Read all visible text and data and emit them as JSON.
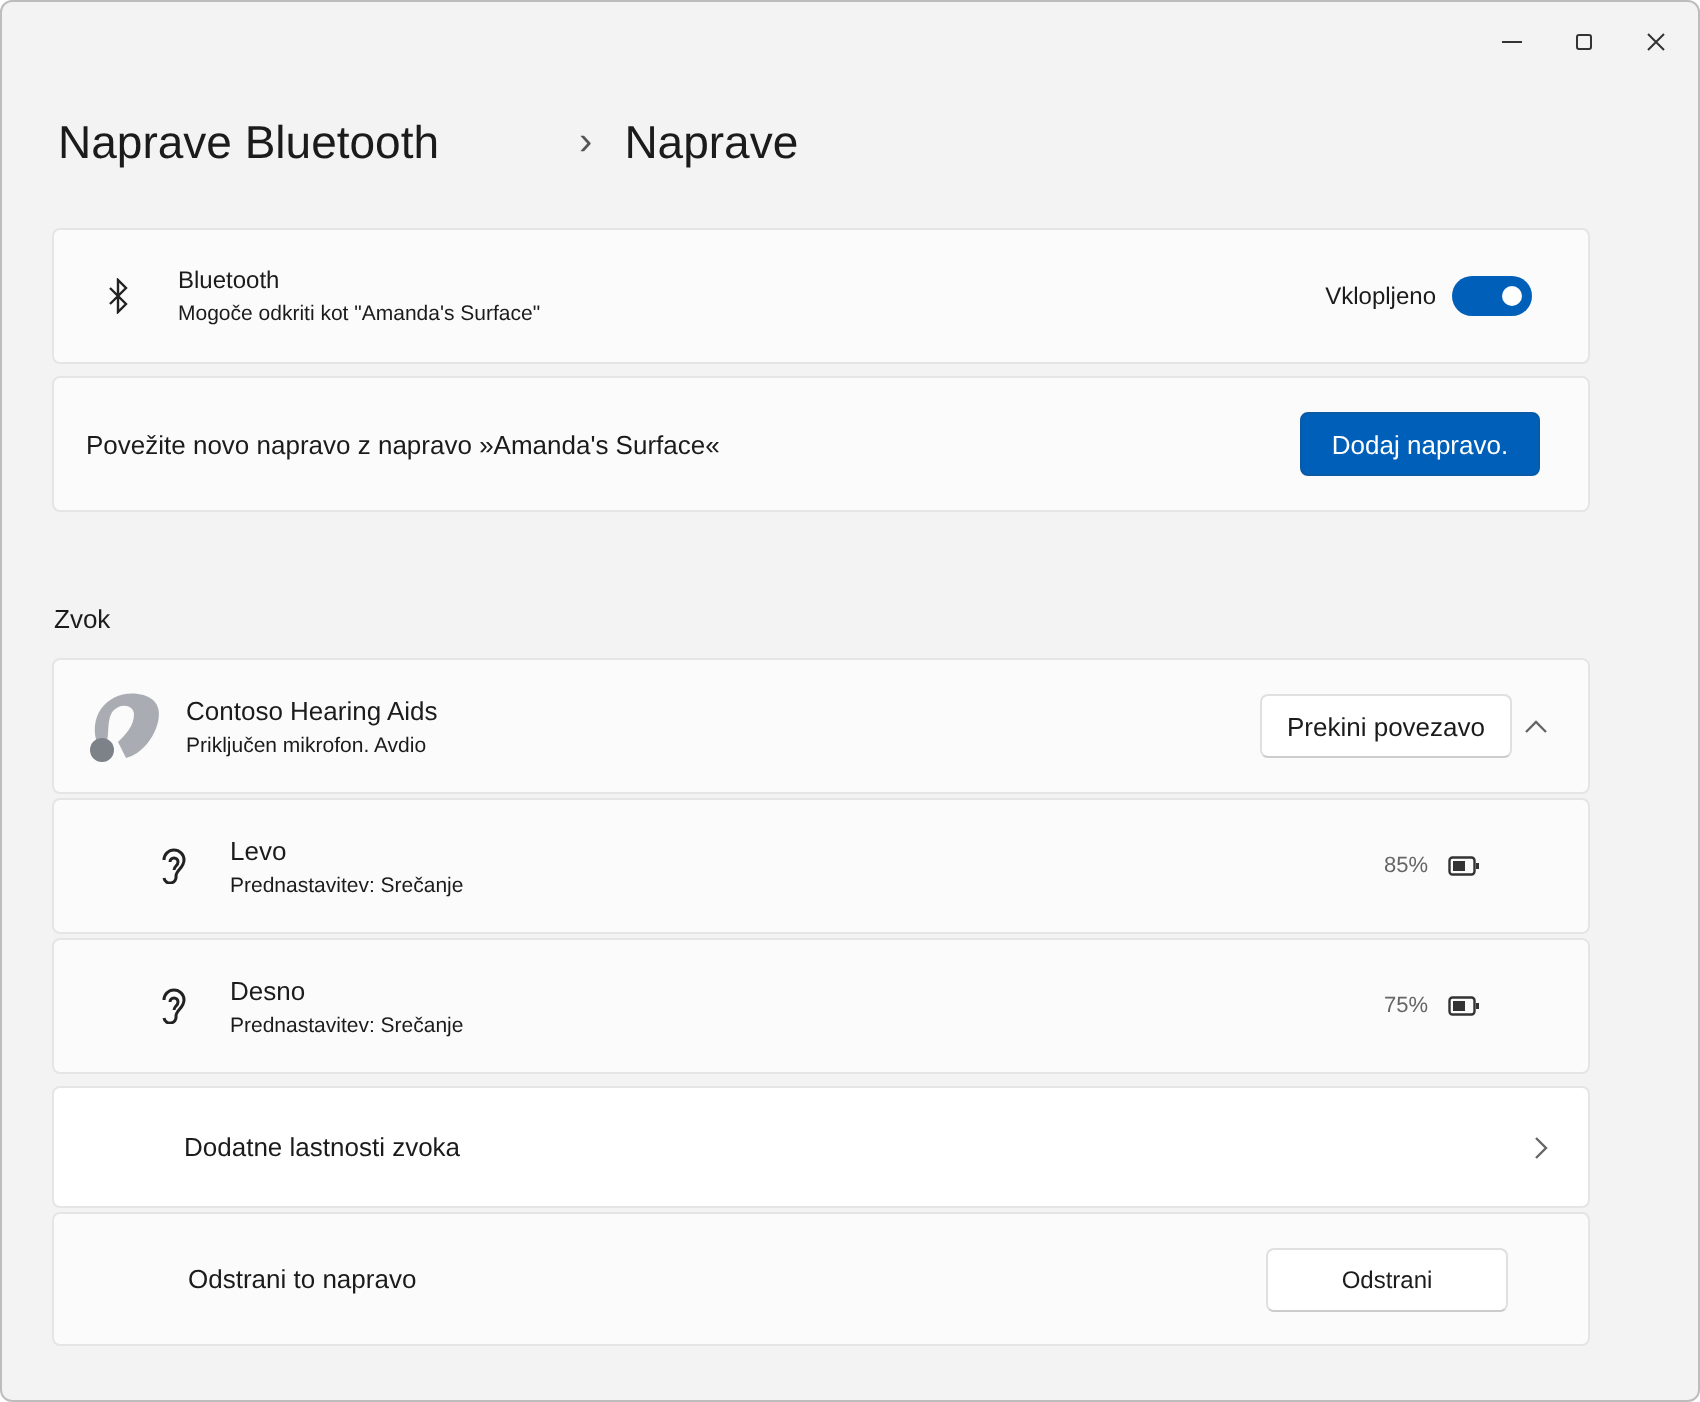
{
  "breadcrumb": {
    "parent": "Naprave Bluetooth",
    "separator": "›",
    "current": "Naprave"
  },
  "bluetooth": {
    "title": "Bluetooth",
    "subtitle": "Mogoče odkriti kot \"Amanda's Surface\"",
    "toggle_label": "Vklopljeno",
    "on": true
  },
  "pair": {
    "text": "Povežite novo napravo z napravo »Amanda's Surface«",
    "button": "Dodaj napravo."
  },
  "section": "Zvok",
  "device": {
    "name": "Contoso Hearing Aids",
    "status": "Priključen mikrofon. Avdio",
    "button": "Prekini povezavo",
    "expanded": true,
    "parts": [
      {
        "name": "Levo",
        "preset": "Prednastavitev: Srečanje",
        "battery": "85%"
      },
      {
        "name": "Desno",
        "preset": "Prednastavitev: Srečanje",
        "battery": "75%"
      }
    ]
  },
  "links": [
    {
      "kind": "link",
      "label": "Dodatne lastnosti zvoka"
    },
    {
      "kind": "action",
      "label": "Odstrani to napravo",
      "button": "Odstrani"
    }
  ]
}
